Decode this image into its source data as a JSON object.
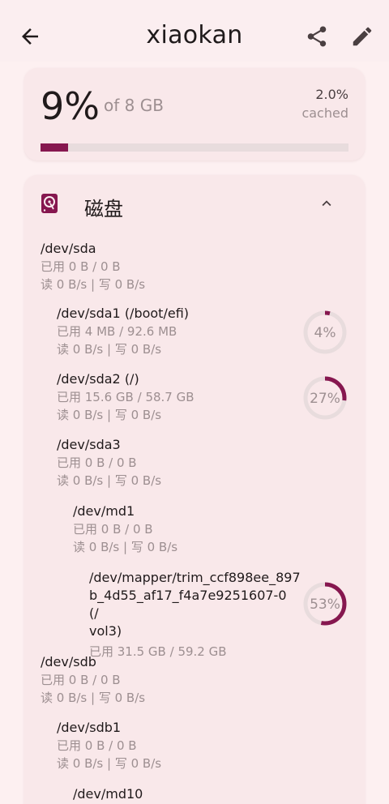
{
  "appbar": {
    "title": "xiaokan"
  },
  "memory": {
    "percent_text": "9%",
    "of_text": "of 8 GB",
    "usage_fraction": 0.09,
    "cached_value": "2.0%",
    "cached_label": "cached"
  },
  "disk": {
    "title": "磁盘",
    "devices": [
      {
        "name": "/dev/sda",
        "used": "已用 0 B / 0 B",
        "io": "读 0 B/s | 写 0 B/s"
      },
      {
        "name": "/dev/sda1 (/boot/efi)",
        "used": "已用 4 MB / 92.6 MB",
        "io": "读 0 B/s | 写 0 B/s",
        "percent": 4,
        "percent_text": "4%"
      },
      {
        "name": "/dev/sda2 (/)",
        "used": "已用 15.6 GB / 58.7 GB",
        "io": "读 0 B/s | 写 0 B/s",
        "percent": 27,
        "percent_text": "27%"
      },
      {
        "name": "/dev/sda3",
        "used": "已用 0 B / 0 B",
        "io": "读 0 B/s | 写 0 B/s"
      },
      {
        "name": "/dev/md1",
        "used": "已用 0 B / 0 B",
        "io": "读 0 B/s | 写 0 B/s"
      },
      {
        "name_lines": [
          "/dev/mapper/trim_ccf898ee_897",
          "b_4d55_af17_f4a7e9251607-0 (/",
          "vol3)"
        ],
        "used": "已用 31.5 GB / 59.2 GB",
        "percent": 53,
        "percent_text": "53%"
      },
      {
        "name": "/dev/sdb",
        "used": "已用 0 B / 0 B",
        "io": "读 0 B/s | 写 0 B/s"
      },
      {
        "name": "/dev/sdb1",
        "used": "已用 0 B / 0 B",
        "io": "读 0 B/s | 写 0 B/s"
      },
      {
        "name": "/dev/md10"
      }
    ]
  },
  "colors": {
    "accent": "#86174f",
    "track": "#e8dcdd",
    "background": "#fdf0f1",
    "card": "#f9e8ea"
  }
}
